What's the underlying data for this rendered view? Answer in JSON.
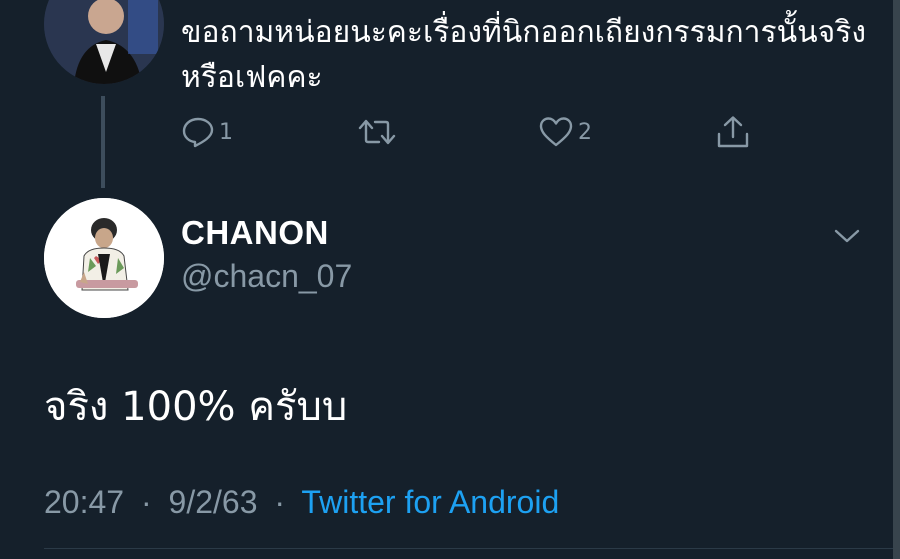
{
  "parent_tweet": {
    "text": "ขอถามหน่อยนะคะเรื่องที่นิกออกเถียงกรรมการนั้นจริงหรือเฟคคะ",
    "reply_count": "1",
    "retweet_count": "",
    "like_count": "2"
  },
  "reply_tweet": {
    "display_name": "CHANON",
    "handle": "@chacn_07",
    "text": "จริง 100% ครับบ",
    "time": "20:47",
    "date": "9/2/63",
    "separator": "·",
    "source": "Twitter for Android"
  },
  "colors": {
    "background": "#15202b",
    "secondary_text": "#8899a6",
    "link": "#1da1f2"
  },
  "icons": [
    "reply-icon",
    "retweet-icon",
    "like-icon",
    "share-icon",
    "chevron-down-icon"
  ]
}
